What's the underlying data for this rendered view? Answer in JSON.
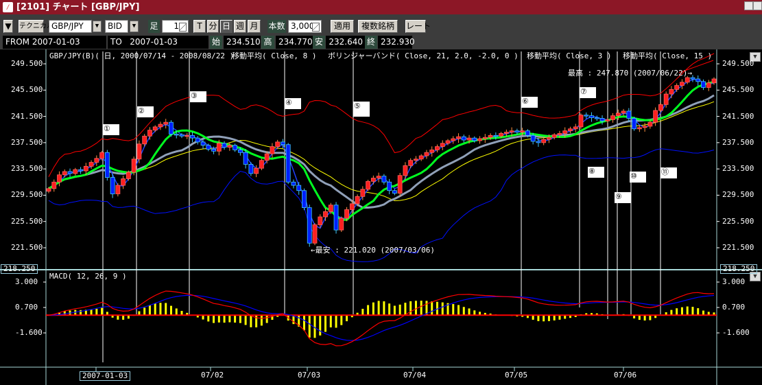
{
  "window": {
    "title": "[2101] チャート [GBP/JPY]"
  },
  "toolbar": {
    "menu_button": "▼",
    "technical": "テクニカル",
    "symbol": "GBP/JPY",
    "side": "BID",
    "ashi_label": "足",
    "ashi_value": "1",
    "periods": [
      "T",
      "分",
      "日",
      "週",
      "月"
    ],
    "selected_period": "日",
    "count_label": "本数",
    "count_value": "3,000",
    "apply": "適用",
    "multi": "複数銘柄",
    "rate": "レート"
  },
  "range": {
    "from_label": "FROM",
    "from": "2007-01-03",
    "to_label": "TO",
    "to": "2007-01-03",
    "open_label": "始",
    "open": "234.510",
    "high_label": "高",
    "high": "234.770",
    "low_label": "安",
    "low": "232.640",
    "close_label": "終",
    "close": "232.930"
  },
  "chart_header": {
    "series": "GBP/JPY(B)( 日, 2000/07/14 - 2008/08/22 )",
    "ma8": "移動平均( Close, 8 )",
    "bb": "ボリンジャーバンド( Close, 21, 2.0, -2.0, 0 )",
    "ma3": "移動平均( Close, 3 )",
    "ma15": "移動平均( Close, 15 )"
  },
  "annotations": {
    "high": "最高 : 247.870 (2007/06/22)→",
    "low": "←最安 : 221.020 (2007/03/06)"
  },
  "markers": [
    "①",
    "②",
    "③",
    "④",
    "⑤",
    "⑥",
    "⑦",
    "⑧",
    "⑨",
    "⑩",
    "⑪"
  ],
  "macd_header": "MACD( 12, 26, 9 )",
  "colors": {
    "up": "#ff2020",
    "down": "#0020ff",
    "ma3": "#2040ff",
    "ma8": "#00ff20",
    "ma15": "#90a0b8",
    "bb_upper": "#ff0000",
    "bb_lower": "#0010ff",
    "bb_mid": "#ffff00",
    "macd": "#ff0000",
    "signal": "#0000ff",
    "hist": "#ffff00",
    "title_bar": "#8c1726"
  },
  "chart_data": [
    {
      "type": "candlestick",
      "title": "",
      "ylim": [
        218.25,
        251.5
      ],
      "y_ticks": [
        "249.500",
        "245.500",
        "241.500",
        "237.500",
        "233.500",
        "229.500",
        "225.500",
        "221.500"
      ],
      "y_bottom_label": "218.250",
      "x_ticks": [
        "2007-01-03",
        "07/02",
        "07/03",
        "07/04",
        "07/05",
        "07/06"
      ],
      "close": [
        230.5,
        231.5,
        232.6,
        233.1,
        232.8,
        233.4,
        233.2,
        233.9,
        234.5,
        235.1,
        236.0,
        232.2,
        229.7,
        231.0,
        232.0,
        233.0,
        235.0,
        237.3,
        238.5,
        239.4,
        239.9,
        240.3,
        240.6,
        238.8,
        238.7,
        238.5,
        238.6,
        238.2,
        237.6,
        237.1,
        236.5,
        236.2,
        237.4,
        236.8,
        237.1,
        236.4,
        236.0,
        234.2,
        232.8,
        233.6,
        234.8,
        235.8,
        236.9,
        237.6,
        237.2,
        231.5,
        231.0,
        230.2,
        227.6,
        222.2,
        225.0,
        226.2,
        227.0,
        228.0,
        224.2,
        226.0,
        227.3,
        228.2,
        229.3,
        230.4,
        231.6,
        232.1,
        232.4,
        231.5,
        230.2,
        229.8,
        232.5,
        234.0,
        234.8,
        235.0,
        235.5,
        236.0,
        236.4,
        236.9,
        237.4,
        237.8,
        238.1,
        238.4,
        237.9,
        238.2,
        237.8,
        238.1,
        238.3,
        238.6,
        238.5,
        238.9,
        239.1,
        239.3,
        239.1,
        239.3,
        238.6,
        237.7,
        237.5,
        238.0,
        238.3,
        238.7,
        238.9,
        239.3,
        239.6,
        239.9,
        241.7,
        241.6,
        241.3,
        241.2,
        240.8,
        241.0,
        241.6,
        242.0,
        242.3,
        241.2,
        239.6,
        239.8,
        240.0,
        240.6,
        242.4,
        243.3,
        244.9,
        245.6,
        246.2,
        246.7,
        247.4,
        247.2,
        246.8,
        245.9,
        246.6,
        247.2
      ],
      "indicators": {
        "ma": [
          3,
          8,
          15
        ],
        "bollinger": {
          "period": 21,
          "k": 2.0
        }
      }
    },
    {
      "type": "macd",
      "params": [
        12,
        26,
        9
      ],
      "y_ticks": [
        "3.000",
        "0.700",
        "-1.600"
      ]
    }
  ]
}
